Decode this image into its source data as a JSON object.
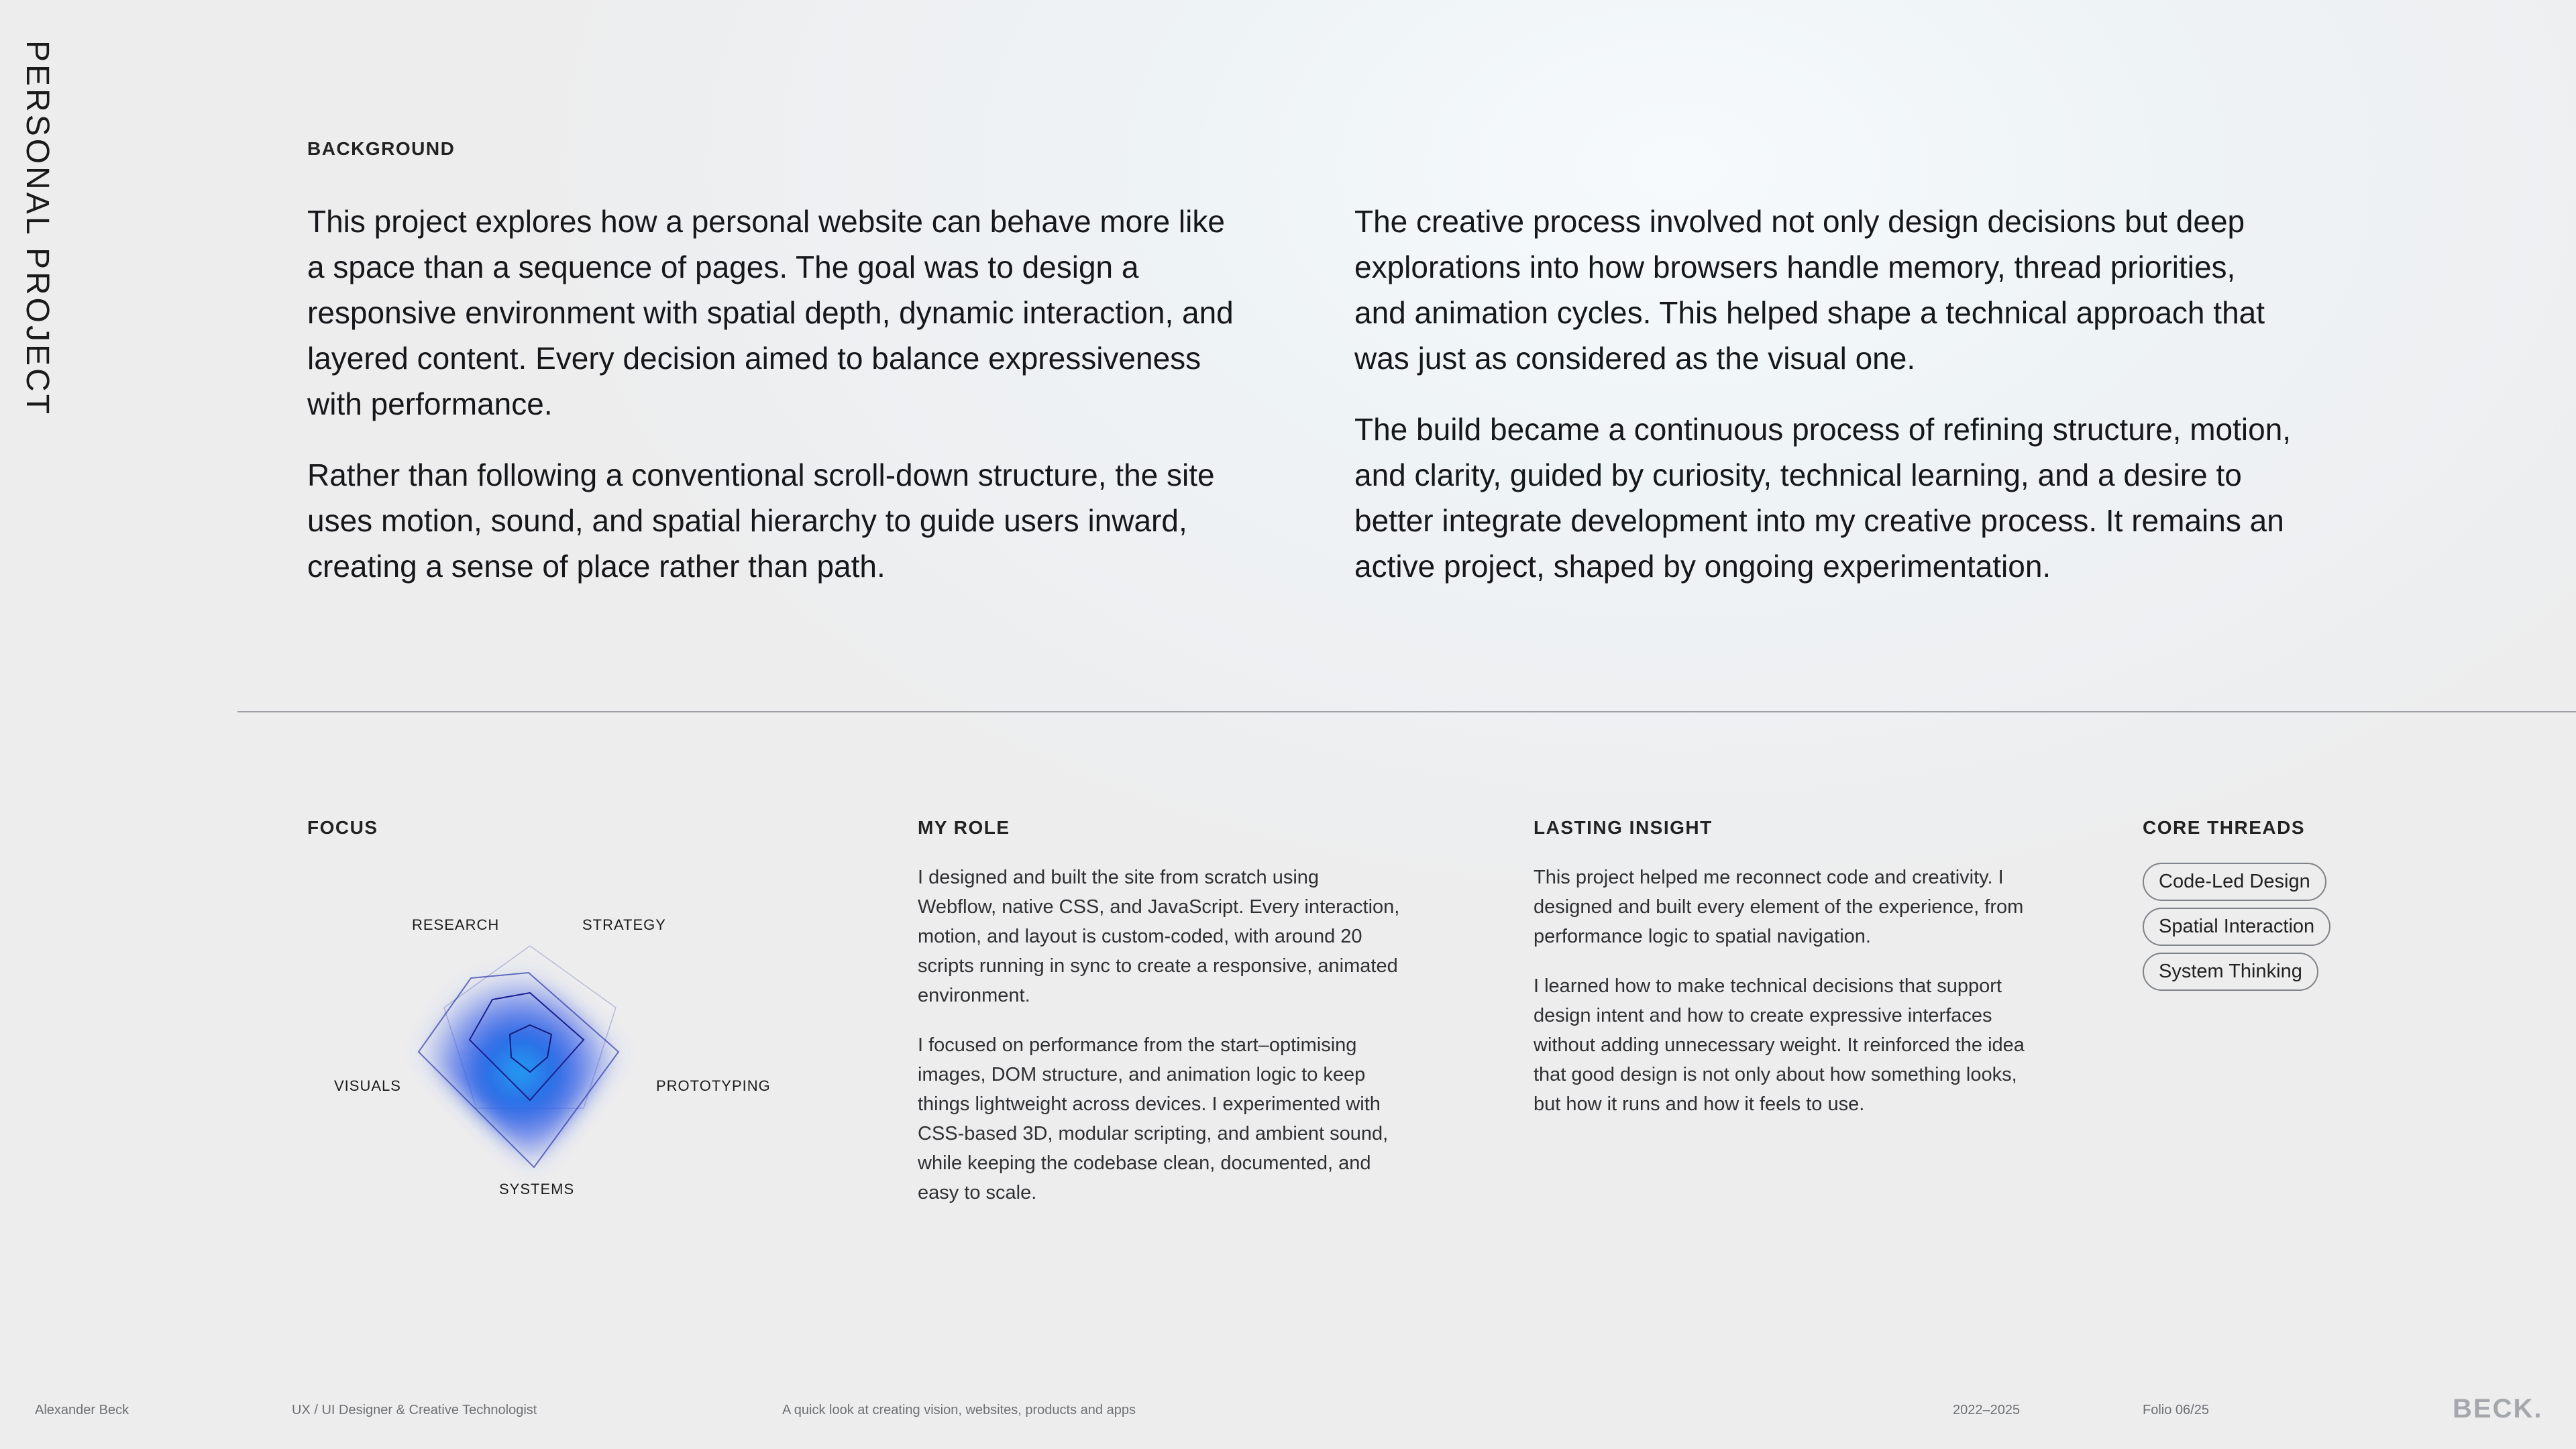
{
  "side_title": "PERSONAL PROJECT",
  "background": {
    "label": "BACKGROUND",
    "left": [
      "This project explores how a personal website can behave more like a space than a sequence of pages. The goal was to design a responsive environment with spatial depth, dynamic interaction, and layered content. Every decision aimed to balance expressiveness with performance.",
      "Rather than following a conventional scroll-down structure, the site uses motion, sound, and spatial hierarchy to guide users inward, creating a sense of place rather than path."
    ],
    "right": [
      "The creative process involved not only design decisions but deep explorations into how browsers handle memory, thread priorities, and animation cycles. This helped shape a technical approach that was just as considered as the visual one.",
      "The build became a continuous process of refining structure, motion, and clarity, guided by curiosity, technical learning, and a desire to better integrate development into my creative process. It remains an active project, shaped by ongoing experimentation."
    ]
  },
  "focus": {
    "label": "FOCUS",
    "axes": [
      "RESEARCH",
      "STRATEGY",
      "PROTOTYPING",
      "SYSTEMS",
      "VISUALS"
    ],
    "accent_color": "#1f6fe0"
  },
  "role": {
    "label": "MY ROLE",
    "paragraphs": [
      "I designed and built the site from scratch using Webflow, native CSS, and JavaScript. Every interaction, motion, and layout is custom-coded, with around 20 scripts running in sync to create a responsive, animated environment.",
      "I focused on performance from the start–optimising images, DOM structure, and animation logic to keep things lightweight across devices. I experimented with CSS-based 3D, modular scripting, and ambient sound, while keeping the codebase clean, documented, and easy to scale."
    ]
  },
  "insight": {
    "label": "LASTING INSIGHT",
    "paragraphs": [
      "This project helped me reconnect code and creativity. I designed and built every element of the experience, from performance logic to spatial navigation.",
      "I learned how to make technical decisions that support design intent and how to create expressive interfaces without adding unnecessary weight. It reinforced the idea that good design is not only about how something looks, but how it runs and how it feels to use."
    ]
  },
  "threads": {
    "label": "CORE THREADS",
    "items": [
      "Code-Led Design",
      "Spatial Interaction",
      "System Thinking"
    ]
  },
  "footer": {
    "name": "Alexander Beck",
    "role": "UX / UI Designer & Creative Technologist",
    "tagline": "A quick look at creating vision, websites, products and apps",
    "years": "2022–2025",
    "folio": "Folio 06/25",
    "logo": "BECK."
  }
}
